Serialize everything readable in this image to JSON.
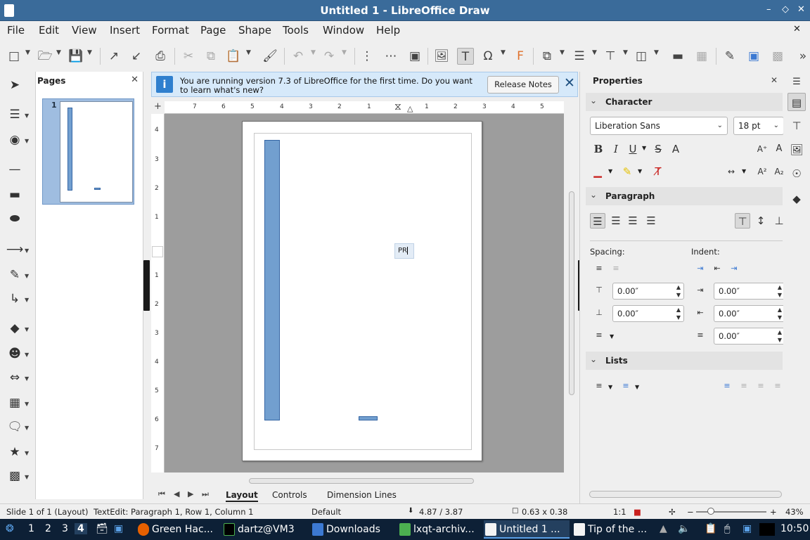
{
  "window": {
    "title": "Untitled 1 - LibreOffice Draw",
    "min": "–",
    "max": "◇",
    "close": "✕"
  },
  "menubar": {
    "items": [
      "File",
      "Edit",
      "View",
      "Insert",
      "Format",
      "Page",
      "Shape",
      "Tools",
      "Window",
      "Help"
    ],
    "close": "✕"
  },
  "pages_panel": {
    "title": "Pages",
    "close": "✕",
    "page_number": "1"
  },
  "infobar": {
    "message": "You are running version 7.3 of LibreOffice for the first time. Do you want to learn what's new?",
    "button": "Release Notes",
    "close": "✕",
    "icon": "i"
  },
  "ruler": {
    "h_labels": [
      "7",
      "6",
      "5",
      "4",
      "3",
      "2",
      "1",
      "1",
      "2",
      "3",
      "4",
      "5"
    ],
    "v_labels": [
      "4",
      "3",
      "2",
      "1",
      "1",
      "2",
      "3",
      "4",
      "5",
      "6",
      "7"
    ]
  },
  "canvas": {
    "text_content": "PR"
  },
  "tabs": {
    "items": [
      "Layout",
      "Controls",
      "Dimension Lines"
    ],
    "active": "Layout"
  },
  "sidebar": {
    "title": "Properties",
    "close": "✕",
    "character": {
      "label": "Character",
      "font": "Liberation Sans",
      "size": "18 pt"
    },
    "paragraph": {
      "label": "Paragraph",
      "spacing_label": "Spacing:",
      "indent_label": "Indent:",
      "above": "0.00″",
      "below": "0.00″",
      "before": "0.00″",
      "after": "0.00″",
      "first_line": "0.00″"
    },
    "lists": {
      "label": "Lists"
    }
  },
  "statusbar": {
    "slide": "Slide 1 of 1 (Layout)",
    "edit": "TextEdit: Paragraph 1, Row 1, Column 1",
    "master": "Default",
    "position": "4.87 / 3.87",
    "size": "0.63 x 0.38",
    "scale": "1:1",
    "zoom_minus": "−",
    "zoom_plus": "+",
    "zoom": "43%"
  },
  "taskbar": {
    "workspaces": [
      "1",
      "2",
      "3",
      "4"
    ],
    "windows": [
      {
        "label": "Green Hac...",
        "color": "#e66000"
      },
      {
        "label": "dartz@VM3",
        "color": "#000000"
      },
      {
        "label": "Downloads",
        "color": "#3c79d2"
      },
      {
        "label": "lxqt-archiv...",
        "color": "#4caf50"
      },
      {
        "label": "Untitled 1 ...",
        "color": "#f3f3f3"
      },
      {
        "label": "Tip of the ...",
        "color": "#f3f3f3"
      }
    ],
    "clock": "10:50"
  },
  "icons": {
    "bold": "B",
    "italic": "I",
    "underline": "U",
    "strike": "S"
  }
}
